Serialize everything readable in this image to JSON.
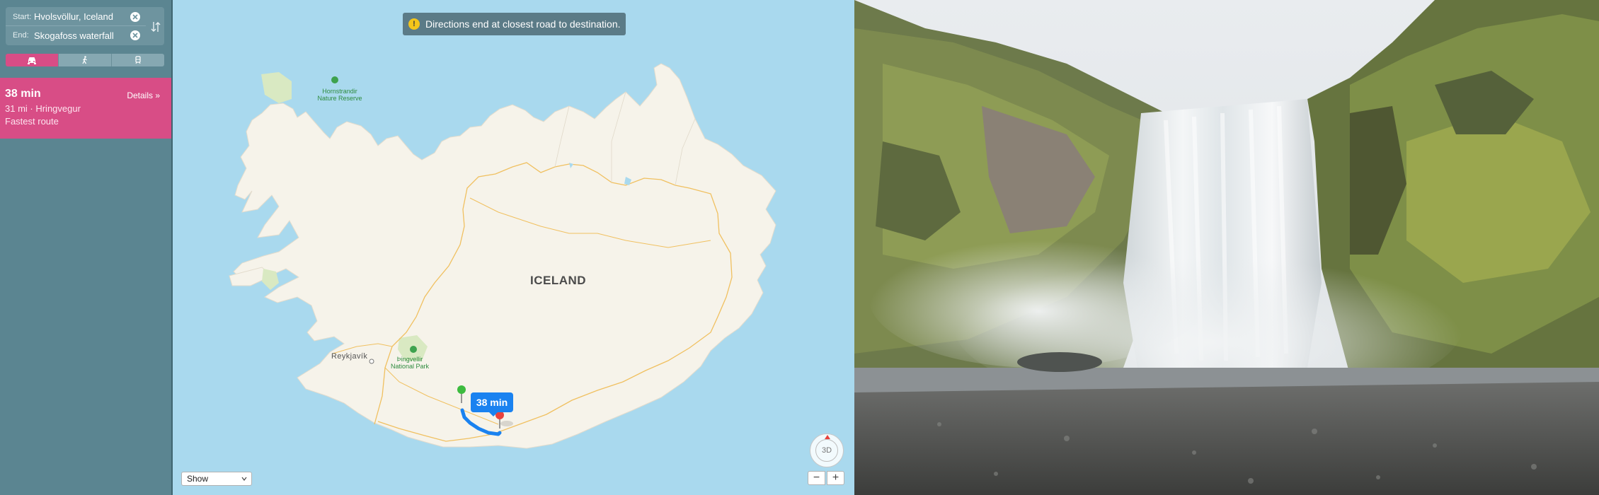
{
  "directions": {
    "start_label": "Start:",
    "start_value": "Hvolsvöllur, Iceland",
    "end_label": "End:",
    "end_value": "Skogafoss waterfall"
  },
  "transport_modes": [
    {
      "name": "car-icon",
      "active": true
    },
    {
      "name": "walk-icon",
      "active": false
    },
    {
      "name": "transit-icon",
      "active": false
    }
  ],
  "route": {
    "time": "38 min",
    "details": "Details »",
    "summary": "31 mi · Hringvegur",
    "type": "Fastest route"
  },
  "map": {
    "notice": "Directions end at closest road to destination.",
    "country_label": "ICELAND",
    "city_label": "Reykjavík",
    "park_1": "Hornstrandir\nNature Reserve",
    "park_1_line1": "Hornstrandir",
    "park_1_line2": "Nature Reserve",
    "park_2_line1": "Þingvellir",
    "park_2_line2": "National Park",
    "eta_bubble": "38 min",
    "show_menu": "Show",
    "compass_label": "3D",
    "zoom_out": "−",
    "zoom_in": "+"
  },
  "colors": {
    "sidebar": "#5b8591",
    "accent": "#d84d86",
    "water": "#a9d9ee",
    "land": "#f6f3ea",
    "route": "#1a82f0",
    "roads": "#f0c060"
  }
}
